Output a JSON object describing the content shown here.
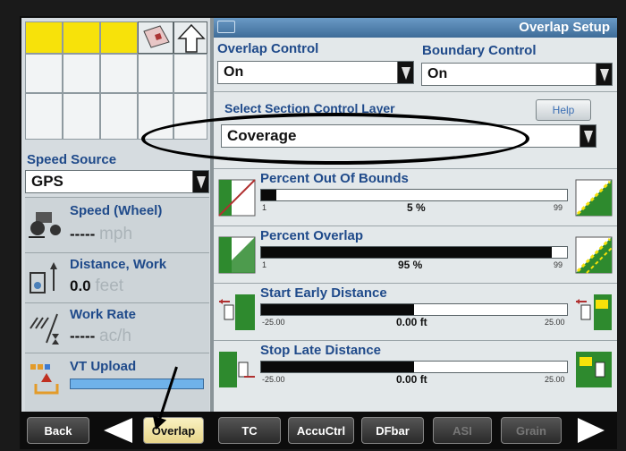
{
  "header": {
    "title": "Overlap Setup"
  },
  "left": {
    "speed_source_label": "Speed Source",
    "speed_source_value": "GPS",
    "speed_label": "Speed (Wheel)",
    "speed_value": "-----",
    "speed_unit": "mph",
    "distance_label": "Distance, Work",
    "distance_value": "0.0",
    "distance_unit": "feet",
    "work_rate_label": "Work Rate",
    "work_rate_value": "-----",
    "work_rate_unit": "ac/h",
    "vt_upload_label": "VT Upload"
  },
  "overlap_control": {
    "label": "Overlap Control",
    "value": "On"
  },
  "boundary_control": {
    "label": "Boundary Control",
    "value": "On"
  },
  "section_layer": {
    "label": "Select Section Control Layer",
    "value": "Coverage",
    "help": "Help"
  },
  "sliders": [
    {
      "label": "Percent Out Of Bounds",
      "min": "1",
      "max": "99",
      "value_text": "5 %",
      "fraction": 0.05
    },
    {
      "label": "Percent Overlap",
      "min": "1",
      "max": "99",
      "value_text": "95 %",
      "fraction": 0.95
    },
    {
      "label": "Start Early Distance",
      "min": "-25.00",
      "max": "25.00",
      "value_text": "0.00 ft",
      "fraction": 0.5
    },
    {
      "label": "Stop Late Distance",
      "min": "-25.00",
      "max": "25.00",
      "value_text": "0.00 ft",
      "fraction": 0.5
    }
  ],
  "bottom": {
    "back": "Back",
    "overlap": "Overlap",
    "tc": "TC",
    "accuctrl": "AccuCtrl",
    "dfbar": "DFbar",
    "asi": "ASI",
    "grain": "Grain"
  },
  "colors": {
    "accent": "#1f4a8a",
    "title_bg": "#4d7fae",
    "green": "#2e8a2e",
    "yellow": "#f7e20a"
  }
}
